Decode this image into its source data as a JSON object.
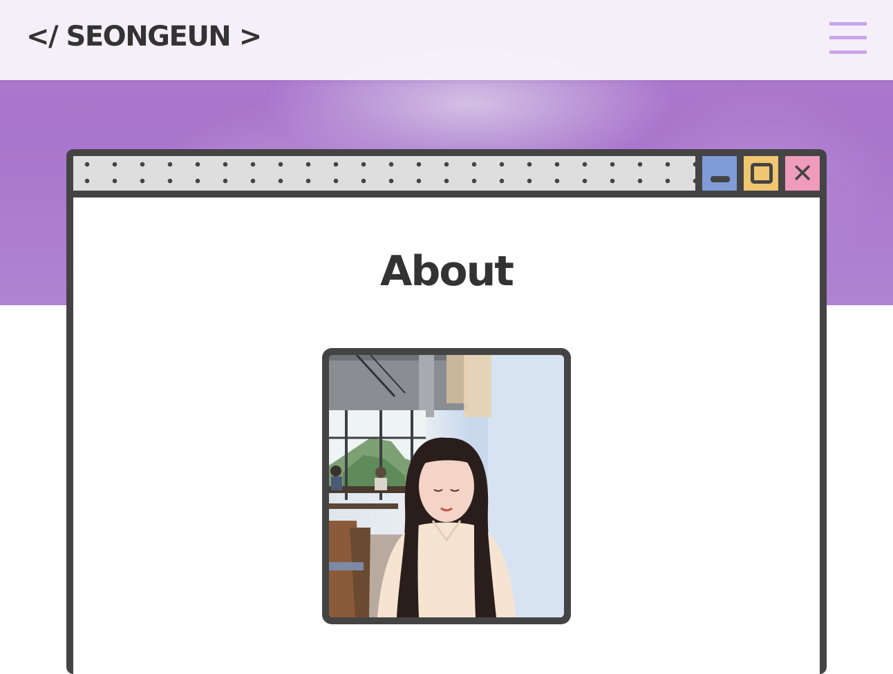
{
  "header": {
    "logo": "</ SEONGEUN >",
    "menu_icon": "hamburger-menu-icon"
  },
  "window": {
    "buttons": {
      "minimize_icon": "minimize-icon",
      "maximize_icon": "maximize-icon",
      "close_icon": "close-icon",
      "close_glyph": "✕"
    },
    "colors": {
      "minimize": "#7f9bd8",
      "maximize": "#f0c670",
      "close": "#ef9bbb"
    }
  },
  "about": {
    "title": "About"
  },
  "colors": {
    "accent": "#c9a6ec",
    "hero": "#a874cc",
    "frame": "#444444"
  }
}
